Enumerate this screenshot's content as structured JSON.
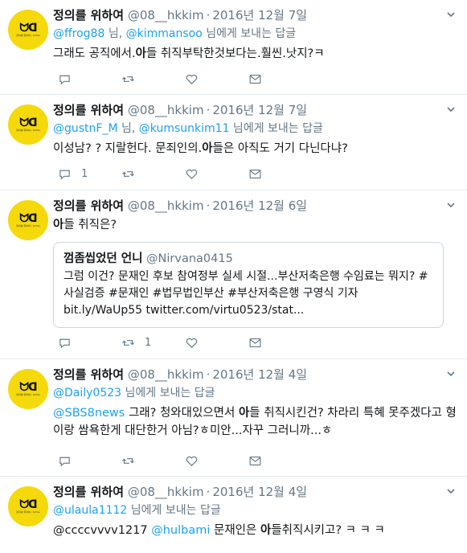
{
  "tweets": [
    {
      "name": "정의를 위하여",
      "handle": "@08__hkkim",
      "date": "2016년 12월 7일",
      "reply_mentions": [
        "@ffrog88",
        "@kimmansoo"
      ],
      "reply_sep": " 님, ",
      "reply_suffix": " 님에게 보내는 답글",
      "text_parts": [
        "그래도 공직에서.",
        "아",
        "들 취직부탁한것보다는.훨씬.낫지?ㅋ"
      ],
      "reply_count": "",
      "retweet_count": "",
      "like_count": ""
    },
    {
      "name": "정의를 위하여",
      "handle": "@08__hkkim",
      "date": "2016년 12월 7일",
      "reply_mentions": [
        "@gustnF_M",
        "@kumsunkim11"
      ],
      "reply_sep": " 님, ",
      "reply_suffix": " 님에게 보내는 답글",
      "text_parts": [
        "이성남? ? 지랄헌다. 문죄인의.",
        "아",
        "들은 아직도 거기 다닌다냐?"
      ],
      "reply_count": "1",
      "retweet_count": "",
      "like_count": ""
    },
    {
      "name": "정의를 위하여",
      "handle": "@08__hkkim",
      "date": "2016년 12월 6일",
      "text_parts": [
        "",
        "아",
        "들 취직은?"
      ],
      "quote": {
        "name": "껌좀씹었던 언니",
        "handle": "@Nirvana0415",
        "text": "그럼 이건? 문재인 후보 참여정부 실세 시절...부산저축은행 수임료는 뭐지? #사실검증 #문재인 #법무법인부산 #부산저축은행 구영식 기자 bit.ly/WaUp55 twitter.com/virtu0523/stat..."
      },
      "reply_count": "",
      "retweet_count": "1",
      "like_count": ""
    },
    {
      "name": "정의를 위하여",
      "handle": "@08__hkkim",
      "date": "2016년 12월 4일",
      "reply_mentions": [
        "@Daily0523"
      ],
      "reply_suffix": " 님에게 보내는 답글",
      "text_mention": "@SBS8news",
      "text_parts": [
        " 그래? 청와대있으면서 ",
        "아",
        "들 취직시킨건? 차라리 특혜 못주겠다고 형이랑 쌈욕한게 대단한거 아님?ㅎ미안...자꾸 그러니까...ㅎ"
      ],
      "reply_count": "",
      "retweet_count": "",
      "like_count": ""
    },
    {
      "name": "정의를 위하여",
      "handle": "@08__hkkim",
      "date": "2016년 12월 4일",
      "reply_mentions": [
        "@ulaula1112"
      ],
      "reply_suffix": " 님에게 보내는 답글",
      "text_lead": "@ccccvvvv1217 ",
      "text_mention": "@hulbami",
      "text_parts": [
        " 문재인은 ",
        "아",
        "들취직시키고? ㅋ ㅋ ㅋ"
      ],
      "reply_count": "",
      "retweet_count": "",
      "like_count": ""
    }
  ],
  "avatar": {
    "glyph": "ᗢᗡ",
    "tiny": "정의를 위하여 / 1970s"
  },
  "colors": {
    "link": "#1da1f2",
    "muted": "#657786",
    "avatar_bg": "#f5d90a",
    "divider": "#e6ecf0"
  },
  "icons": [
    "reply-icon",
    "retweet-icon",
    "like-icon",
    "message-icon",
    "chevron-down-icon"
  ]
}
